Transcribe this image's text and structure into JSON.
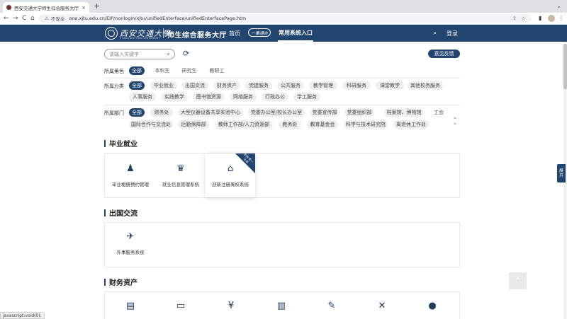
{
  "browser": {
    "tab_title": "西安交通大学师生综合服务大厅",
    "tab_close": "×",
    "new_tab": "+",
    "nav_back": "←",
    "nav_forward": "→",
    "nav_reload": "C",
    "nav_home": "⌂",
    "security": "不安全",
    "url": "one.xjtu.edu.cn/EIP/nonlogin/xjtu/unifiedEnterface/unifiedEnterfacePage.htm",
    "status_text": "javascript:void(0);"
  },
  "header": {
    "logo_cn": "西安交通大學",
    "logo_en": "XI'AN JIAOTONG UNIVERSITY",
    "portal_title": "师生综合服务大厅",
    "nav_home": "首页",
    "nav_brand": "一事通办",
    "nav_current": "常用系统入口",
    "login": "登录"
  },
  "search": {
    "placeholder": "请输入关键字",
    "feedback": "意见反馈"
  },
  "filters": {
    "role": {
      "label": "所属角色",
      "chips": [
        "全部",
        "本科生",
        "研究生",
        "教职工"
      ]
    },
    "category": {
      "label": "所属分类",
      "chips_row1": [
        "全部",
        "毕业就业",
        "出国交流",
        "财务资产",
        "党建服务",
        "公共服务",
        "教学管理",
        "科研服务",
        "课堂教学",
        "其他校务服务"
      ],
      "chips_row2": [
        "人事服务",
        "实践教学",
        "图书馆资源",
        "网络服务",
        "行政办公",
        "学工服务"
      ]
    },
    "department": {
      "label": "所属部门",
      "chips_row1": [
        "全部",
        "财务处",
        "大型仪器设备共享实验中心",
        "党委办公室/校长办公室",
        "党委宣传部",
        "党委组织部",
        "档案馆、博物馆",
        "工会"
      ],
      "chips_row2": [
        "国际合作与交流处",
        "后勤保障部",
        "教师工作部/人力资源部",
        "教务处",
        "教育基金会",
        "科学与技术研究院",
        "离退休工作处"
      ]
    }
  },
  "sections": [
    {
      "title": "毕业就业",
      "services": [
        {
          "label": "毕业相册预约管理",
          "icon": "graduate-icon"
        },
        {
          "label": "就业信息管理系统",
          "icon": "graduate-cap-icon"
        },
        {
          "label": "迎新注册离校系统",
          "icon": "school-icon",
          "ribbon": "支持 统一认证"
        }
      ]
    },
    {
      "title": "出国交流",
      "services": [
        {
          "label": "外事服务系统",
          "icon": "airplane-icon"
        }
      ]
    },
    {
      "title": "财务资产",
      "services": [
        {
          "icon": "ledger-icon"
        },
        {
          "icon": "printer-icon"
        },
        {
          "icon": "money-bag-icon"
        },
        {
          "icon": "building-icon"
        },
        {
          "icon": "pen-icon"
        },
        {
          "icon": "tools-icon"
        },
        {
          "icon": "yuan-icon"
        }
      ]
    }
  ],
  "side": {
    "tab_text_1": "展",
    "tab_text_2": "开"
  }
}
